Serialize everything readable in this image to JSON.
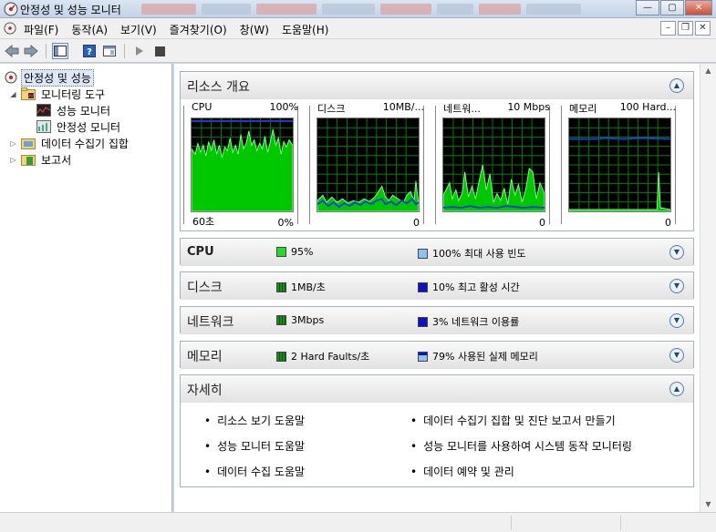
{
  "window": {
    "title": "안정성 및 성능 모니터"
  },
  "menu": [
    "파일(F)",
    "동작(A)",
    "보기(V)",
    "즐겨찾기(O)",
    "창(W)",
    "도움말(H)"
  ],
  "tree": {
    "root": "안정성 및 성능",
    "monitoring_tools": "모니터링 도구",
    "perf_monitor": "성능 모니터",
    "reliability_monitor": "안정성 모니터",
    "data_collector_sets": "데이터 수집기 집합",
    "reports": "보고서"
  },
  "overview": {
    "title": "리소스 개요",
    "graphs": [
      {
        "label": "CPU",
        "max": "100%",
        "left_bottom": "60초",
        "right_bottom": "0%"
      },
      {
        "label": "디스크",
        "max": "10MB/...",
        "left_bottom": "",
        "right_bottom": "0"
      },
      {
        "label": "네트워...",
        "max": "10 Mbps",
        "left_bottom": "",
        "right_bottom": "0"
      },
      {
        "label": "메모리",
        "max": "100 Hard...",
        "left_bottom": "",
        "right_bottom": "0"
      }
    ]
  },
  "sections": {
    "cpu": {
      "title": "CPU",
      "stat1": "95%",
      "stat2": "100% 최대 사용 빈도"
    },
    "disk": {
      "title": "디스크",
      "stat1": "1MB/초",
      "stat2": "10% 최고 활성 시간"
    },
    "network": {
      "title": "네트워크",
      "stat1": "3Mbps",
      "stat2": "3% 네트워크 이용률"
    },
    "memory": {
      "title": "메모리",
      "stat1": "2 Hard Faults/초",
      "stat2": "79% 사용된 실제 메모리"
    }
  },
  "details": {
    "title": "자세히",
    "links": [
      "리소스 보기 도움말",
      "데이터 수집기 집합 및 진단 보고서 만들기",
      "성능 모니터 도움말",
      "성능 모니터를 사용하여 시스템 동작 모니터링",
      "데이터 수집 도움말",
      "데이터 예약 및 관리"
    ]
  },
  "colors": {
    "graph_bg": "#000000",
    "graph_grid": "#008000",
    "graph_fill": "#00c800",
    "graph_line": "#1a3fd6",
    "stat_green": "#22cc22",
    "stat_blue": "#1010c8",
    "stat_light_blue": "#8fc3ef"
  },
  "icons": {
    "app": "monitor-gauge-icon",
    "back": "back-arrow-icon",
    "forward": "forward-arrow-icon",
    "help": "help-icon",
    "play": "play-icon",
    "stop": "stop-icon"
  }
}
